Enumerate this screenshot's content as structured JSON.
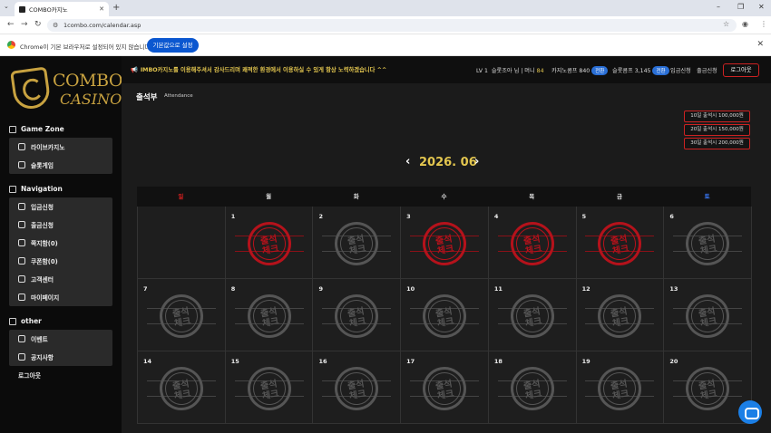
{
  "browser": {
    "tab_title": "COMBO카지노",
    "url": "1combo.com/calendar.asp",
    "info_message": "Chrome이 기본 브라우저로 설정되어 있지 않습니다",
    "info_button": "기본값으로 설정"
  },
  "sidebar": {
    "logo_line1": "COMBO",
    "logo_line2": "CASINO",
    "sections": [
      {
        "title": "Game Zone",
        "items": [
          "라이브카지노",
          "슬롯게임"
        ]
      },
      {
        "title": "Navigation",
        "items": [
          "입금신청",
          "출금신청",
          "쪽지함(0)",
          "쿠폰함(0)",
          "고객센터",
          "마이페이지"
        ]
      },
      {
        "title": "other",
        "items": [
          "이벤트",
          "공지사항"
        ]
      }
    ],
    "logout": "로그아웃"
  },
  "topbar": {
    "marquee": "IMBO카지노를 이용해주셔서 감사드리며 쾌적한 환경에서 이용하실 수 있게 항상 노력하겠습니다 ^^",
    "level": "LV 1",
    "user": "슬롯조아 님 | 머니",
    "money": "84",
    "casino_point": "카지노콤프 840",
    "casino_btn": "전환",
    "slot_point": "슬롯콤프 3,145",
    "slot_btn": "전환",
    "deposit": "입금신청",
    "withdraw": "출금신청",
    "logout": "로그아웃"
  },
  "page": {
    "title": "출석부",
    "subtitle": "Attendance",
    "month": "2026. 06",
    "prev": "‹",
    "next": "›",
    "bonuses": [
      "10일 출석시 100,000원",
      "20일 출석시 150,000원",
      "30일 출석시 200,000원"
    ]
  },
  "calendar": {
    "weekdays": [
      "일",
      "월",
      "화",
      "수",
      "목",
      "금",
      "토"
    ],
    "weekday_colors": [
      "#e02020",
      "#dddddd",
      "#dddddd",
      "#dddddd",
      "#dddddd",
      "#dddddd",
      "#3a7bff"
    ],
    "stamp_text_1": "출석",
    "stamp_text_2": "체크",
    "weeks": [
      [
        {
          "d": ""
        },
        {
          "d": "1",
          "checked": true
        },
        {
          "d": "2",
          "checked": false
        },
        {
          "d": "3",
          "checked": true
        },
        {
          "d": "4",
          "checked": true
        },
        {
          "d": "5",
          "checked": true
        },
        {
          "d": "6",
          "checked": false
        }
      ],
      [
        {
          "d": "7",
          "checked": false
        },
        {
          "d": "8",
          "checked": false
        },
        {
          "d": "9",
          "checked": false
        },
        {
          "d": "10",
          "checked": false
        },
        {
          "d": "11",
          "checked": false
        },
        {
          "d": "12",
          "checked": false
        },
        {
          "d": "13",
          "checked": false
        }
      ],
      [
        {
          "d": "14",
          "checked": false
        },
        {
          "d": "15",
          "checked": false
        },
        {
          "d": "16",
          "checked": false
        },
        {
          "d": "17",
          "checked": false
        },
        {
          "d": "18",
          "checked": false
        },
        {
          "d": "19",
          "checked": false
        },
        {
          "d": "20",
          "checked": false
        }
      ]
    ]
  }
}
